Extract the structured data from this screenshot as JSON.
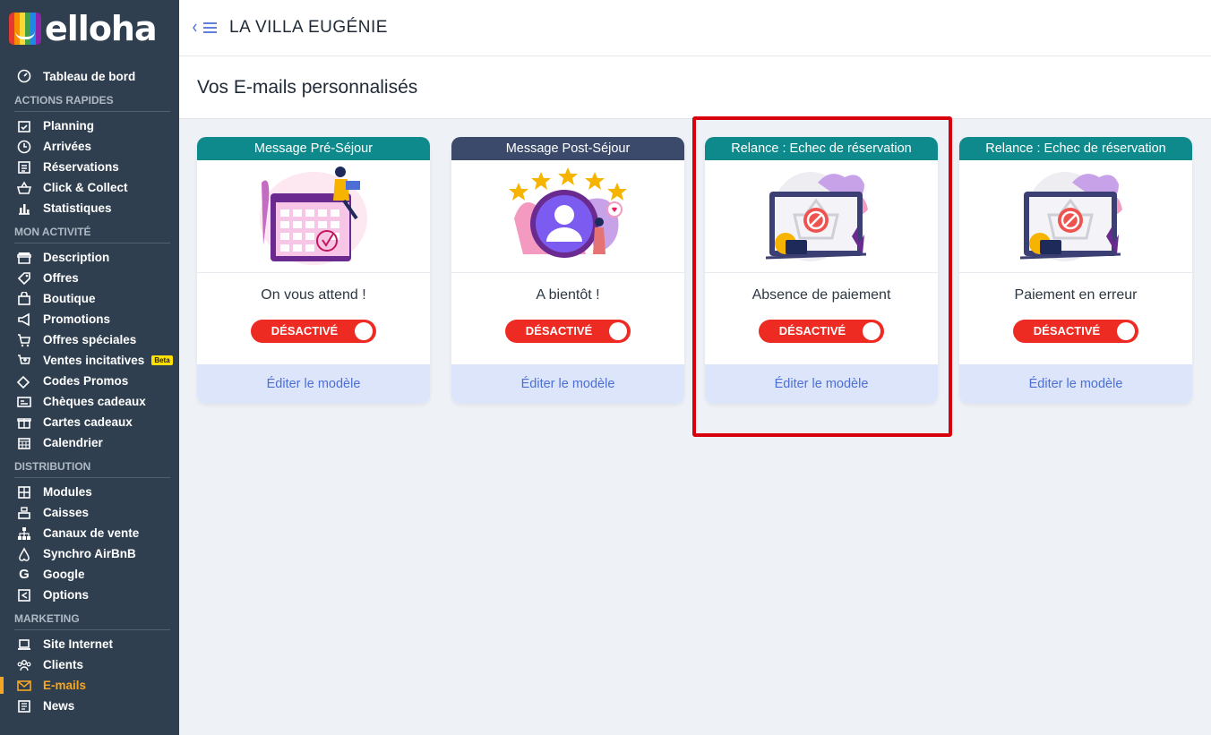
{
  "brand": {
    "name": "elloha"
  },
  "header": {
    "hotel_name": "LA VILLA EUGÉNIE"
  },
  "page": {
    "title": "Vos E-mails personnalisés"
  },
  "sidebar": {
    "dashboard": "Tableau de bord",
    "sections": [
      {
        "title": "ACTIONS RAPIDES",
        "items": [
          {
            "label": "Planning",
            "icon": "calendar-check-icon"
          },
          {
            "label": "Arrivées",
            "icon": "clock-icon"
          },
          {
            "label": "Réservations",
            "icon": "list-check-icon"
          },
          {
            "label": "Click & Collect",
            "icon": "basket-icon"
          },
          {
            "label": "Statistiques",
            "icon": "bar-chart-icon"
          }
        ]
      },
      {
        "title": "MON ACTIVITÉ",
        "items": [
          {
            "label": "Description",
            "icon": "storefront-icon"
          },
          {
            "label": "Offres",
            "icon": "tag-icon"
          },
          {
            "label": "Boutique",
            "icon": "shopping-bag-icon"
          },
          {
            "label": "Promotions",
            "icon": "megaphone-icon"
          },
          {
            "label": "Offres spéciales",
            "icon": "cart-icon"
          },
          {
            "label": "Ventes incitatives",
            "icon": "cart-plus-icon",
            "badge": "Beta"
          },
          {
            "label": "Codes Promos",
            "icon": "ticket-icon"
          },
          {
            "label": "Chèques cadeaux",
            "icon": "voucher-icon"
          },
          {
            "label": "Cartes cadeaux",
            "icon": "gift-icon"
          },
          {
            "label": "Calendrier",
            "icon": "calendar-grid-icon"
          }
        ]
      },
      {
        "title": "DISTRIBUTION",
        "items": [
          {
            "label": "Modules",
            "icon": "grid-icon"
          },
          {
            "label": "Caisses",
            "icon": "register-icon"
          },
          {
            "label": "Canaux de vente",
            "icon": "sitemap-icon"
          },
          {
            "label": "Synchro AirBnB",
            "icon": "airbnb-icon"
          },
          {
            "label": "Google",
            "icon": "google-icon"
          },
          {
            "label": "Options",
            "icon": "share-icon"
          }
        ]
      },
      {
        "title": "MARKETING",
        "items": [
          {
            "label": "Site Internet",
            "icon": "laptop-icon"
          },
          {
            "label": "Clients",
            "icon": "users-icon"
          },
          {
            "label": "E-mails",
            "icon": "envelope-icon",
            "active": true
          },
          {
            "label": "News",
            "icon": "newspaper-icon"
          }
        ]
      }
    ]
  },
  "cards": [
    {
      "header": "Message Pré-Séjour",
      "header_color": "#0e8a8c",
      "subtitle": "On vous attend !",
      "toggle": "DÉSACTIVÉ",
      "footer": "Éditer le modèle",
      "illustration": "calendar-illustration"
    },
    {
      "header": "Message Post-Séjour",
      "header_color": "#3b4a6b",
      "subtitle": "A bientôt !",
      "toggle": "DÉSACTIVÉ",
      "footer": "Éditer le modèle",
      "illustration": "review-stars-illustration"
    },
    {
      "header": "Relance : Echec de réservation",
      "header_color": "#0e8a8c",
      "subtitle": "Absence de paiement",
      "toggle": "DÉSACTIVÉ",
      "footer": "Éditer le modèle",
      "illustration": "failed-payment-illustration"
    },
    {
      "header": "Relance : Echec de réservation",
      "header_color": "#0e8a8c",
      "subtitle": "Paiement en erreur",
      "toggle": "DÉSACTIVÉ",
      "footer": "Éditer le modèle",
      "illustration": "failed-payment-illustration"
    }
  ],
  "colors": {
    "sidebar": "#2f3f4f",
    "accent": "#4c6fd6",
    "toggle_off": "#ee2b22",
    "active": "#f5a623",
    "highlight": "#d9000d"
  }
}
